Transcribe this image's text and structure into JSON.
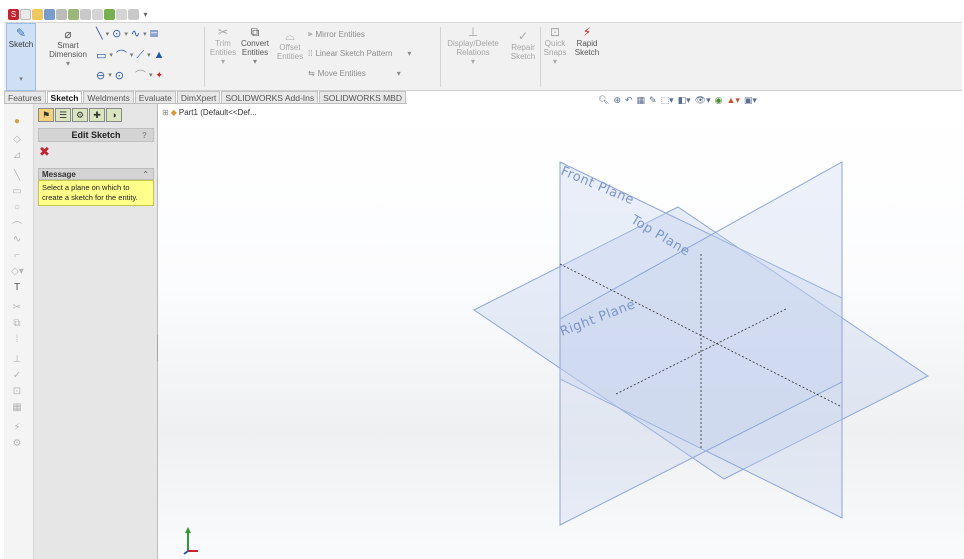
{
  "ribbon": {
    "sketch": "Sketch",
    "smart_dimension_1": "Smart",
    "smart_dimension_2": "Dimension",
    "trim_1": "Trim",
    "trim_2": "Entities",
    "convert_1": "Convert",
    "convert_2": "Entities",
    "offset_1": "Offset",
    "offset_2": "Entities",
    "mirror": "Mirror Entities",
    "linear_pattern": "Linear Sketch Pattern",
    "move": "Move Entities",
    "display_delete_1": "Display/Delete",
    "display_delete_2": "Relations",
    "repair_1": "Repair",
    "repair_2": "Sketch",
    "quick_snaps_1": "Quick",
    "quick_snaps_2": "Snaps",
    "rapid_1": "Rapid",
    "rapid_2": "Sketch"
  },
  "tabs": [
    "Features",
    "Sketch",
    "Weldments",
    "Evaluate",
    "DimXpert",
    "SOLIDWORKS Add-Ins",
    "SOLIDWORKS MBD"
  ],
  "active_tab": "Sketch",
  "panel": {
    "title": "Edit Sketch",
    "help": "?",
    "message_header": "Message",
    "message_text": "Select a plane on which to create a sketch for the entity."
  },
  "tree": {
    "label": "Part1  (Default<<Def..."
  },
  "planes": {
    "front": "Front Plane",
    "top": "Top Plane",
    "right": "Right Plane"
  },
  "colors": {
    "plane_fill": "#c5d3ef",
    "plane_edge": "#8fa6d6",
    "message_bg": "#ffff8a",
    "close_red": "#c8202c"
  }
}
